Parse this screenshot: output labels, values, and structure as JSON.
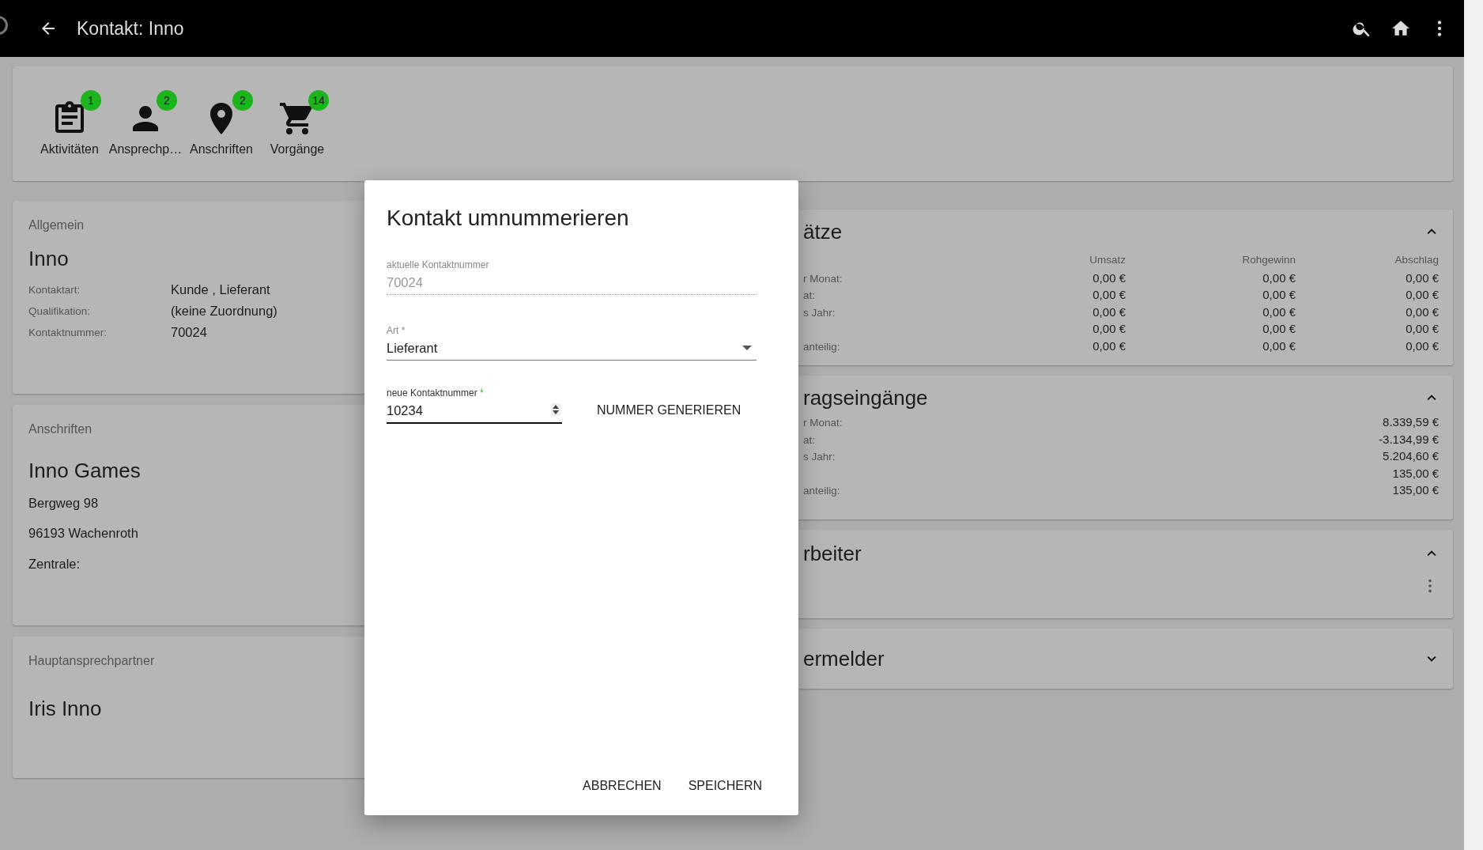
{
  "app_bar": {
    "title": "Kontakt: Inno"
  },
  "shortcuts": [
    {
      "kind": "clipboard",
      "label": "Aktivitäten",
      "count": "1"
    },
    {
      "kind": "person",
      "label": "Ansprechp…",
      "count": "2"
    },
    {
      "kind": "pin",
      "label": "Anschriften",
      "count": "2"
    },
    {
      "kind": "cart",
      "label": "Vorgänge",
      "count": "14"
    }
  ],
  "general": {
    "heading": "Allgemein",
    "name": "Inno",
    "fields": [
      {
        "label": "Kontaktart:",
        "value": "Kunde , Lieferant"
      },
      {
        "label": "Qualifikation:",
        "value": "(keine Zuordnung)"
      },
      {
        "label": "Kontaktnummer:",
        "value": "70024"
      }
    ]
  },
  "addresses": {
    "heading": "Anschriften",
    "name": "Inno Games",
    "lines": [
      "Bergweg 98",
      "96193 Wachenroth",
      "Zentrale:"
    ]
  },
  "main_contact": {
    "heading": "Hauptansprechpartner",
    "name": "Iris Inno"
  },
  "panels": [
    {
      "kind": "table",
      "title": "ätze",
      "expanded": true,
      "columns": [
        "Umsatz",
        "Rohgewinn",
        "Abschlag"
      ],
      "rows": [
        {
          "label": "r Monat:",
          "values": [
            "0,00 €",
            "0,00 €",
            "0,00 €"
          ]
        },
        {
          "label": "at:",
          "values": [
            "0,00 €",
            "0,00 €",
            "0,00 €"
          ]
        },
        {
          "label": "s Jahr:",
          "values": [
            "0,00 €",
            "0,00 €",
            "0,00 €"
          ]
        },
        {
          "values": [
            "0,00 €",
            "0,00 €",
            "0,00 €"
          ]
        },
        {
          "label": "anteilig:",
          "values": [
            "0,00 €",
            "0,00 €",
            "0,00 €"
          ]
        }
      ]
    },
    {
      "kind": "list",
      "title": "ragseingänge",
      "expanded": true,
      "rows": [
        {
          "label": "r Monat:",
          "value": "8.339,59 €"
        },
        {
          "label": "at:",
          "value": "-3.134,99 €"
        },
        {
          "label": "s Jahr:",
          "value": "5.204,60 €"
        },
        {
          "value": "135,00 €"
        },
        {
          "label": "anteilig:",
          "value": "135,00 €"
        }
      ]
    },
    {
      "kind": "menu",
      "title": "rbeiter",
      "expanded": true
    },
    {
      "kind": "plain",
      "title": "ermelder",
      "expanded": false
    }
  ],
  "dialog": {
    "title": "Kontakt umnummerieren",
    "fields": [
      {
        "kind": "readonly",
        "label": "aktuelle Kontaktnummer",
        "value": "70024"
      },
      {
        "kind": "select",
        "label": "Art",
        "required_mark": "*",
        "value": "Lieferant"
      },
      {
        "kind": "number",
        "label": "neue Kontaktnummer",
        "required_mark": "*",
        "value": "10234",
        "focused": true
      }
    ],
    "generate_button": "NUMMER GENERIEREN",
    "buttons": [
      "ABBRECHEN",
      "SPEICHERN"
    ]
  }
}
